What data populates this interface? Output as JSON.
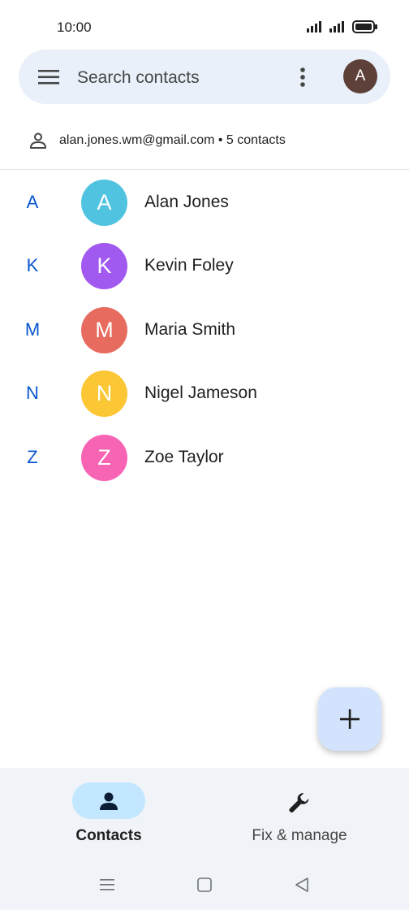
{
  "status_bar": {
    "time": "10:00"
  },
  "search": {
    "placeholder": "Search contacts",
    "avatar_letter": "A"
  },
  "account": {
    "text": "alan.jones.wm@gmail.com • 5 contacts"
  },
  "contacts": [
    {
      "section": "A",
      "initial": "A",
      "name": "Alan Jones",
      "color": "#4fc3e0"
    },
    {
      "section": "K",
      "initial": "K",
      "name": "Kevin Foley",
      "color": "#a259f0"
    },
    {
      "section": "M",
      "initial": "M",
      "name": "Maria Smith",
      "color": "#e86b5f"
    },
    {
      "section": "N",
      "initial": "N",
      "name": "Nigel Jameson",
      "color": "#fbc735"
    },
    {
      "section": "Z",
      "initial": "Z",
      "name": "Zoe Taylor",
      "color": "#f764b4"
    }
  ],
  "fab": {
    "icon": "plus-icon"
  },
  "bottom_nav": {
    "contacts_label": "Contacts",
    "fix_label": "Fix & manage"
  },
  "colors": {
    "accent": "#0b57d0",
    "search_bg": "#eaf0f9",
    "nav_active_pill": "#c2e7ff",
    "fab_bg": "#d3e3fd",
    "avatar_top": "#5d4037"
  }
}
